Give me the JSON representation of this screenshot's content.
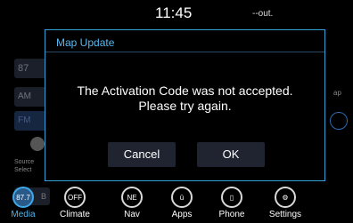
{
  "status": {
    "clock": "11:45",
    "temp": "--out."
  },
  "background": {
    "preset_number": "87",
    "am_label": "AM",
    "fm_label": "FM",
    "source_label": "Source Select",
    "bottom_label": "B",
    "map_label": "ap"
  },
  "dialog": {
    "title": "Map Update",
    "message_line1": "The Activation Code was not accepted.",
    "message_line2": "Please try again.",
    "cancel_label": "Cancel",
    "ok_label": "OK"
  },
  "nav": {
    "items": [
      {
        "label": "Media",
        "icon_text": "87.7",
        "icon": "radio-icon",
        "active": true
      },
      {
        "label": "Climate",
        "icon_text": "OFF",
        "icon": "climate-icon",
        "active": false
      },
      {
        "label": "Nav",
        "icon_text": "NE",
        "icon": "compass-icon",
        "active": false
      },
      {
        "label": "Apps",
        "icon_text": "ū",
        "icon": "apps-icon",
        "active": false
      },
      {
        "label": "Phone",
        "icon_text": "▯",
        "icon": "phone-icon",
        "active": false
      },
      {
        "label": "Settings",
        "icon_text": "⚙",
        "icon": "gear-icon",
        "active": false
      }
    ]
  }
}
